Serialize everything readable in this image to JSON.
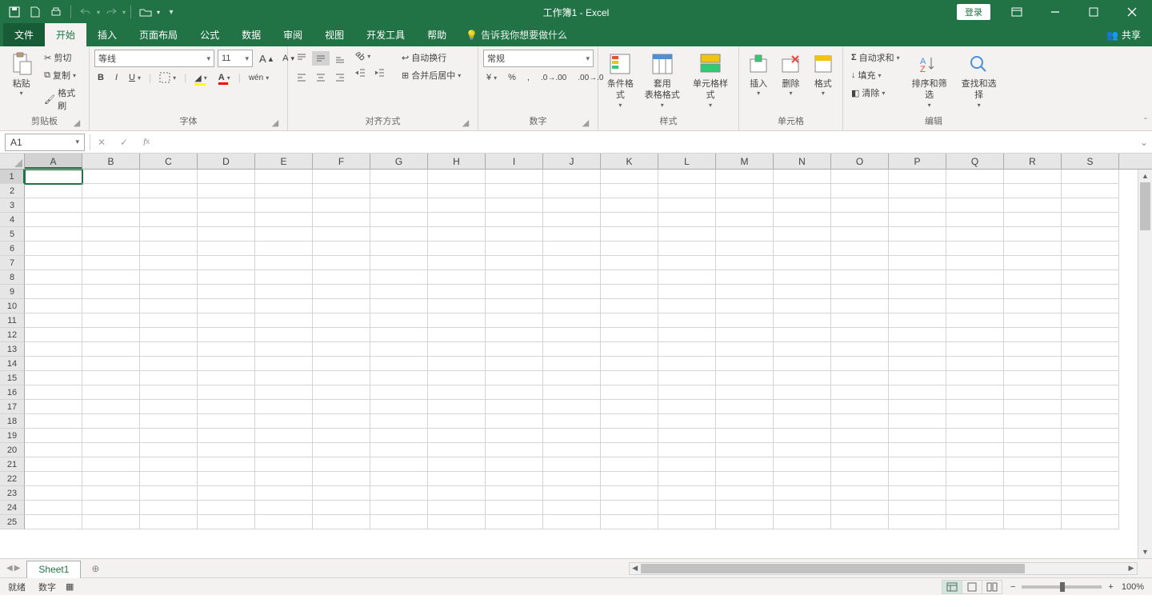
{
  "title": "工作簿1  -  Excel",
  "login": "登录",
  "share": "共享",
  "tell_me": "告诉我你想要做什么",
  "tabs": {
    "file": "文件",
    "home": "开始",
    "insert": "插入",
    "layout": "页面布局",
    "formulas": "公式",
    "data": "数据",
    "review": "审阅",
    "view": "视图",
    "dev": "开发工具",
    "help": "帮助"
  },
  "ribbon": {
    "clipboard": {
      "label": "剪贴板",
      "paste": "粘贴",
      "cut": "剪切",
      "copy": "复制",
      "painter": "格式刷"
    },
    "font": {
      "label": "字体",
      "family": "等线",
      "size": "11"
    },
    "align": {
      "label": "对齐方式",
      "wrap": "自动换行",
      "merge": "合并后居中"
    },
    "number": {
      "label": "数字",
      "format": "常规"
    },
    "styles": {
      "label": "样式",
      "cond": "条件格式",
      "table": "套用\n表格格式",
      "cell": "单元格样式"
    },
    "cells": {
      "label": "单元格",
      "insert": "插入",
      "delete": "删除",
      "format": "格式"
    },
    "editing": {
      "label": "编辑",
      "sum": "自动求和",
      "fill": "填充",
      "clear": "清除",
      "sort": "排序和筛选",
      "find": "查找和选择"
    }
  },
  "name_box": "A1",
  "columns": [
    "A",
    "B",
    "C",
    "D",
    "E",
    "F",
    "G",
    "H",
    "I",
    "J",
    "K",
    "L",
    "M",
    "N",
    "O",
    "P",
    "Q",
    "R",
    "S"
  ],
  "row_count": 25,
  "sheet_tab": "Sheet1",
  "status": {
    "ready": "就绪",
    "num": "数字",
    "zoom": "100%"
  }
}
